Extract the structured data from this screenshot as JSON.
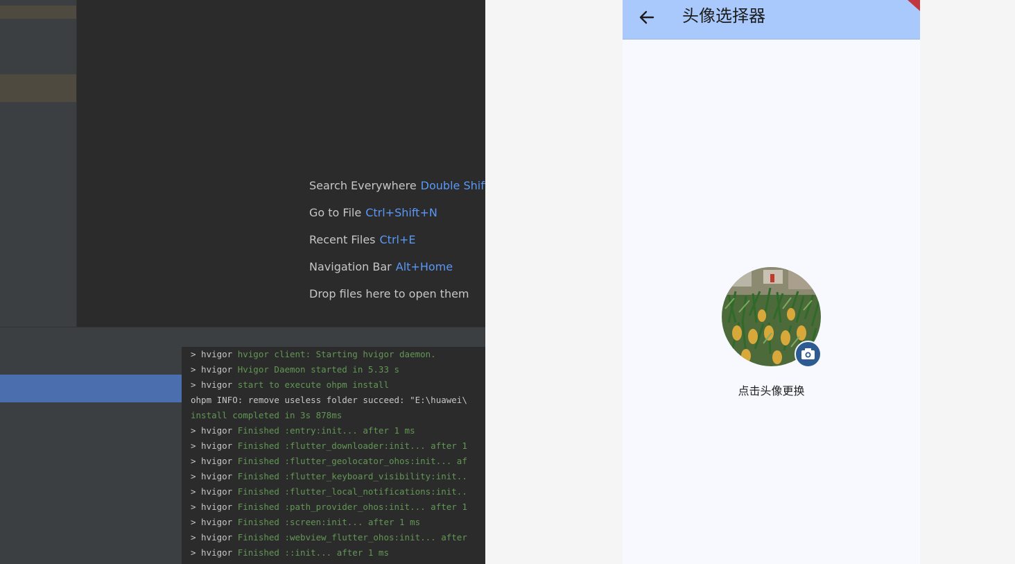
{
  "ide": {
    "hints": [
      {
        "label": "Search Everywhere",
        "shortcut": "Double Shift"
      },
      {
        "label": "Go to File",
        "shortcut": "Ctrl+Shift+N"
      },
      {
        "label": "Recent Files",
        "shortcut": "Ctrl+E"
      },
      {
        "label": "Navigation Bar",
        "shortcut": "Alt+Home"
      },
      {
        "label": "Drop files here to open them",
        "shortcut": ""
      }
    ],
    "console": [
      {
        "prefix": "> hvigor ",
        "text": "hvigor client: Starting hvigor daemon.",
        "style": "green"
      },
      {
        "prefix": "> hvigor ",
        "text": "Hvigor Daemon started in 5.33 s",
        "style": "green"
      },
      {
        "prefix": "> hvigor ",
        "text": "start to execute ohpm install",
        "style": "green"
      },
      {
        "prefix": "",
        "text": "ohpm INFO: remove useless folder succeed: \"E:\\huawei\\",
        "style": "plain"
      },
      {
        "prefix": "",
        "text": "install completed in 3s 878ms",
        "style": "green"
      },
      {
        "prefix": "> hvigor ",
        "text": "Finished :entry:init... after 1 ms",
        "style": "green"
      },
      {
        "prefix": "> hvigor ",
        "text": "Finished :flutter_downloader:init... after 1",
        "style": "green"
      },
      {
        "prefix": "> hvigor ",
        "text": "Finished :flutter_geolocator_ohos:init... af",
        "style": "green"
      },
      {
        "prefix": "> hvigor ",
        "text": "Finished :flutter_keyboard_visibility:init..",
        "style": "green"
      },
      {
        "prefix": "> hvigor ",
        "text": "Finished :flutter_local_notifications:init..",
        "style": "green"
      },
      {
        "prefix": "> hvigor ",
        "text": "Finished :path_provider_ohos:init... after 1",
        "style": "green"
      },
      {
        "prefix": "> hvigor ",
        "text": "Finished :screen:init... after 1 ms",
        "style": "green"
      },
      {
        "prefix": "> hvigor ",
        "text": "Finished :webview_flutter_ohos:init... after",
        "style": "green"
      },
      {
        "prefix": "> hvigor ",
        "text": "Finished ::init... after 1 ms",
        "style": "green"
      }
    ]
  },
  "app": {
    "title": "头像选择器",
    "back_icon": "arrow-left-icon",
    "camera_icon": "camera-icon",
    "caption": "点击头像更换",
    "colors": {
      "appbar": "#a9c8fb",
      "background": "#f7f9ff",
      "camera_button": "#2e5c90"
    }
  }
}
